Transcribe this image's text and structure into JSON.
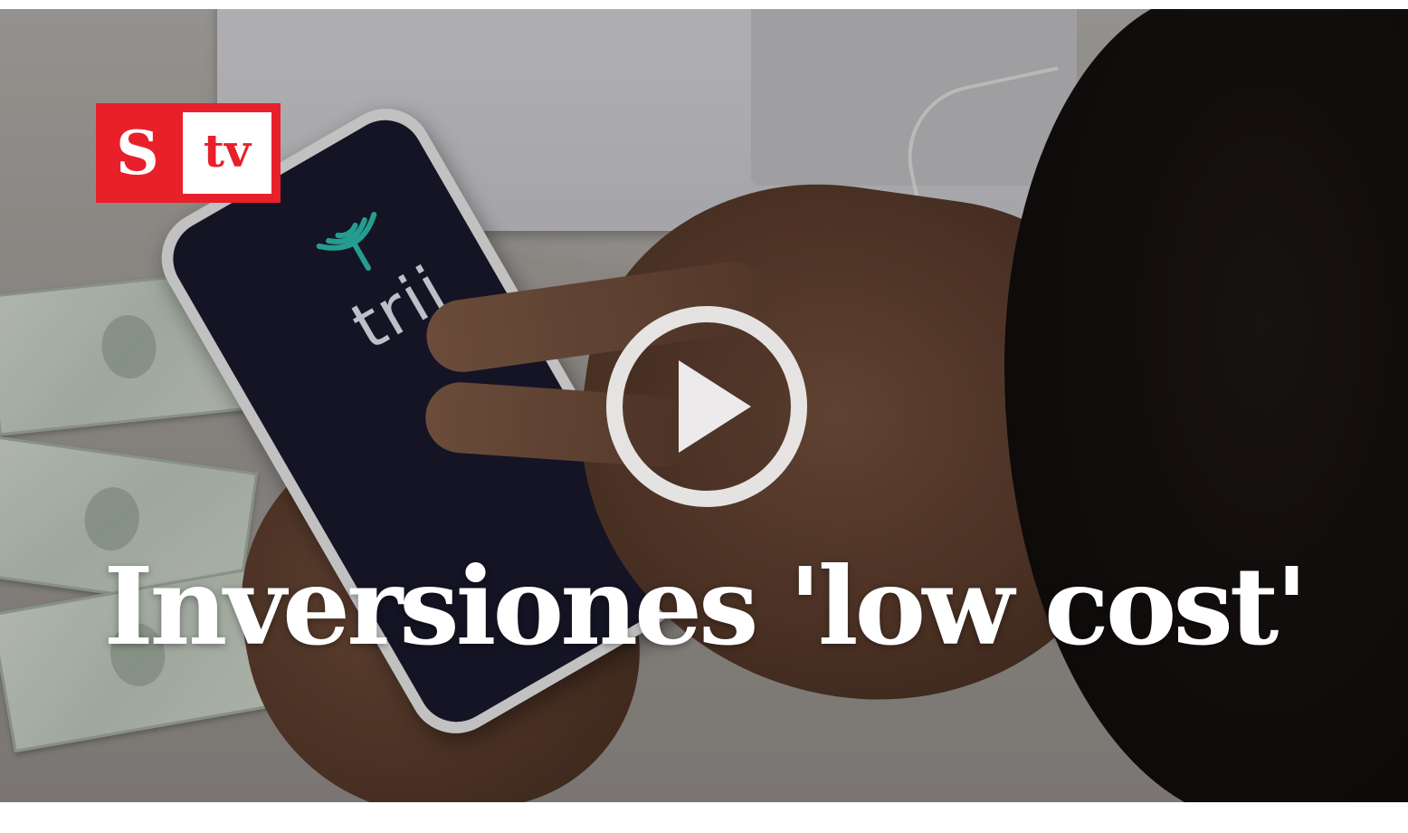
{
  "video": {
    "headline": "Inversiones 'low cost'",
    "brand": {
      "letter": "S",
      "suffix": "tv",
      "color": "#e8202a"
    },
    "phone_app_name": "trii",
    "play_icon": "play-icon"
  }
}
